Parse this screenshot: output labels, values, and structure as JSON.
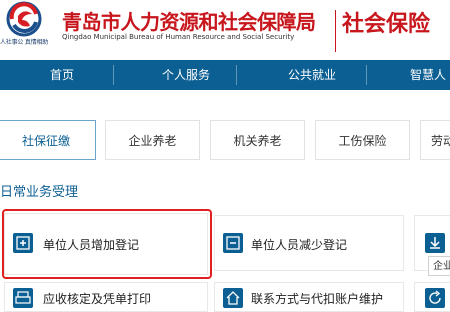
{
  "header": {
    "slogan": "人社事公 真情相助",
    "title_cn": "青岛市人力资源和社会保障局",
    "title_en": "Qingdao Municipal Bureau of Human Resource and Social Security",
    "right_title": "社会保险"
  },
  "nav": {
    "items": [
      {
        "label": "首页"
      },
      {
        "label": "个人服务"
      },
      {
        "label": "公共就业"
      },
      {
        "label": "智慧人"
      }
    ]
  },
  "tabs": [
    {
      "label": "社保征缴",
      "active": true
    },
    {
      "label": "企业养老",
      "active": false
    },
    {
      "label": "机关养老",
      "active": false
    },
    {
      "label": "工伤保险",
      "active": false
    },
    {
      "label": "劳动",
      "active": false
    }
  ],
  "section": {
    "title": "日常业务受理"
  },
  "cards": [
    {
      "label": "单位人员增加登记",
      "icon": "plus-icon"
    },
    {
      "label": "单位人员减少登记",
      "icon": "minus-icon"
    },
    {
      "label": "",
      "icon": "download-icon"
    },
    {
      "label": "应收核定及凭单打印",
      "icon": "print-icon"
    },
    {
      "label": "联系方式与代扣账户维护",
      "icon": "home-icon"
    },
    {
      "label": "",
      "icon": "refresh-icon"
    }
  ],
  "tooltip": {
    "text": "企业"
  },
  "colors": {
    "brand_red": "#c8161d",
    "nav_blue": "#0c5f93",
    "highlight_red": "#e02020"
  }
}
